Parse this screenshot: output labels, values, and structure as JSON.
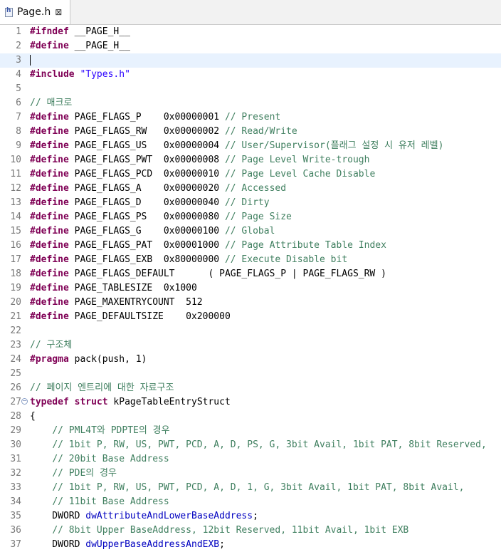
{
  "tab": {
    "title": "Page.h",
    "icon": "header-file-icon",
    "close_glyph": "⊠"
  },
  "current_line": 3,
  "lines": [
    {
      "n": "1",
      "tokens": [
        [
          "kw",
          "#ifndef"
        ],
        [
          "t",
          " __PAGE_H__"
        ]
      ]
    },
    {
      "n": "2",
      "tokens": [
        [
          "kw",
          "#define"
        ],
        [
          "t",
          " __PAGE_H__"
        ]
      ]
    },
    {
      "n": "3",
      "tokens": []
    },
    {
      "n": "4",
      "tokens": [
        [
          "kw",
          "#include"
        ],
        [
          "t",
          " "
        ],
        [
          "st",
          "\"Types.h\""
        ]
      ]
    },
    {
      "n": "5",
      "tokens": []
    },
    {
      "n": "6",
      "tokens": [
        [
          "cm",
          "// 매크로"
        ]
      ]
    },
    {
      "n": "7",
      "tokens": [
        [
          "kw",
          "#define"
        ],
        [
          "t",
          " PAGE_FLAGS_P    0x00000001 "
        ],
        [
          "cm",
          "// Present"
        ]
      ]
    },
    {
      "n": "8",
      "tokens": [
        [
          "kw",
          "#define"
        ],
        [
          "t",
          " PAGE_FLAGS_RW   0x00000002 "
        ],
        [
          "cm",
          "// Read/Write"
        ]
      ]
    },
    {
      "n": "9",
      "tokens": [
        [
          "kw",
          "#define"
        ],
        [
          "t",
          " PAGE_FLAGS_US   0x00000004 "
        ],
        [
          "cm",
          "// User/Supervisor(플래그 설정 시 유저 레벨)"
        ]
      ]
    },
    {
      "n": "10",
      "tokens": [
        [
          "kw",
          "#define"
        ],
        [
          "t",
          " PAGE_FLAGS_PWT  0x00000008 "
        ],
        [
          "cm",
          "// Page Level Write-trough"
        ]
      ]
    },
    {
      "n": "11",
      "tokens": [
        [
          "kw",
          "#define"
        ],
        [
          "t",
          " PAGE_FLAGS_PCD  0x00000010 "
        ],
        [
          "cm",
          "// Page Level Cache Disable"
        ]
      ]
    },
    {
      "n": "12",
      "tokens": [
        [
          "kw",
          "#define"
        ],
        [
          "t",
          " PAGE_FLAGS_A    0x00000020 "
        ],
        [
          "cm",
          "// Accessed"
        ]
      ]
    },
    {
      "n": "13",
      "tokens": [
        [
          "kw",
          "#define"
        ],
        [
          "t",
          " PAGE_FLAGS_D    0x00000040 "
        ],
        [
          "cm",
          "// Dirty"
        ]
      ]
    },
    {
      "n": "14",
      "tokens": [
        [
          "kw",
          "#define"
        ],
        [
          "t",
          " PAGE_FLAGS_PS   0x00000080 "
        ],
        [
          "cm",
          "// Page Size"
        ]
      ]
    },
    {
      "n": "15",
      "tokens": [
        [
          "kw",
          "#define"
        ],
        [
          "t",
          " PAGE_FLAGS_G    0x00000100 "
        ],
        [
          "cm",
          "// Global"
        ]
      ]
    },
    {
      "n": "16",
      "tokens": [
        [
          "kw",
          "#define"
        ],
        [
          "t",
          " PAGE_FLAGS_PAT  0x00001000 "
        ],
        [
          "cm",
          "// Page Attribute Table Index"
        ]
      ]
    },
    {
      "n": "17",
      "tokens": [
        [
          "kw",
          "#define"
        ],
        [
          "t",
          " PAGE_FLAGS_EXB  0x80000000 "
        ],
        [
          "cm",
          "// Execute Disable bit"
        ]
      ]
    },
    {
      "n": "18",
      "tokens": [
        [
          "kw",
          "#define"
        ],
        [
          "t",
          " PAGE_FLAGS_DEFAULT      ( PAGE_FLAGS_P | PAGE_FLAGS_RW )"
        ]
      ]
    },
    {
      "n": "19",
      "tokens": [
        [
          "kw",
          "#define"
        ],
        [
          "t",
          " PAGE_TABLESIZE  0x1000"
        ]
      ]
    },
    {
      "n": "20",
      "tokens": [
        [
          "kw",
          "#define"
        ],
        [
          "t",
          " PAGE_MAXENTRYCOUNT  512"
        ]
      ]
    },
    {
      "n": "21",
      "tokens": [
        [
          "kw",
          "#define"
        ],
        [
          "t",
          " PAGE_DEFAULTSIZE    0x200000"
        ]
      ]
    },
    {
      "n": "22",
      "tokens": []
    },
    {
      "n": "23",
      "tokens": [
        [
          "cm",
          "// 구조체"
        ]
      ]
    },
    {
      "n": "24",
      "tokens": [
        [
          "kw",
          "#pragma"
        ],
        [
          "t",
          " pack(push, 1)"
        ]
      ]
    },
    {
      "n": "25",
      "tokens": []
    },
    {
      "n": "26",
      "tokens": [
        [
          "cm",
          "// 페이지 엔트리에 대한 자료구조"
        ]
      ]
    },
    {
      "n": "27",
      "fold": "⊖",
      "tokens": [
        [
          "kw",
          "typedef"
        ],
        [
          "t",
          " "
        ],
        [
          "kw",
          "struct"
        ],
        [
          "t",
          " kPageTableEntryStruct"
        ]
      ]
    },
    {
      "n": "28",
      "tokens": [
        [
          "t",
          "{"
        ]
      ]
    },
    {
      "n": "29",
      "tokens": [
        [
          "t",
          "    "
        ],
        [
          "cm",
          "// PML4T와 PDPTE의 경우"
        ]
      ]
    },
    {
      "n": "30",
      "tokens": [
        [
          "t",
          "    "
        ],
        [
          "cm",
          "// 1bit P, RW, US, PWT, PCD, A, D, PS, G, 3bit Avail, 1bit PAT, 8bit Reserved,"
        ]
      ]
    },
    {
      "n": "31",
      "tokens": [
        [
          "t",
          "    "
        ],
        [
          "cm",
          "// 20bit Base Address"
        ]
      ]
    },
    {
      "n": "32",
      "tokens": [
        [
          "t",
          "    "
        ],
        [
          "cm",
          "// PDE의 경우"
        ]
      ]
    },
    {
      "n": "33",
      "tokens": [
        [
          "t",
          "    "
        ],
        [
          "cm",
          "// 1bit P, RW, US, PWT, PCD, A, D, 1, G, 3bit Avail, 1bit PAT, 8bit Avail,"
        ]
      ]
    },
    {
      "n": "34",
      "tokens": [
        [
          "t",
          "    "
        ],
        [
          "cm",
          "// 11bit Base Address"
        ]
      ]
    },
    {
      "n": "35",
      "tokens": [
        [
          "t",
          "    DWORD "
        ],
        [
          "var",
          "dwAttributeAndLowerBaseAddress"
        ],
        [
          "t",
          ";"
        ]
      ]
    },
    {
      "n": "36",
      "tokens": [
        [
          "t",
          "    "
        ],
        [
          "cm",
          "// 8bit Upper BaseAddress, 12bit Reserved, 11bit Avail, 1bit EXB"
        ]
      ]
    },
    {
      "n": "37",
      "tokens": [
        [
          "t",
          "    DWORD "
        ],
        [
          "var",
          "dwUpperBaseAddressAndEXB"
        ],
        [
          "t",
          ";"
        ]
      ]
    }
  ]
}
